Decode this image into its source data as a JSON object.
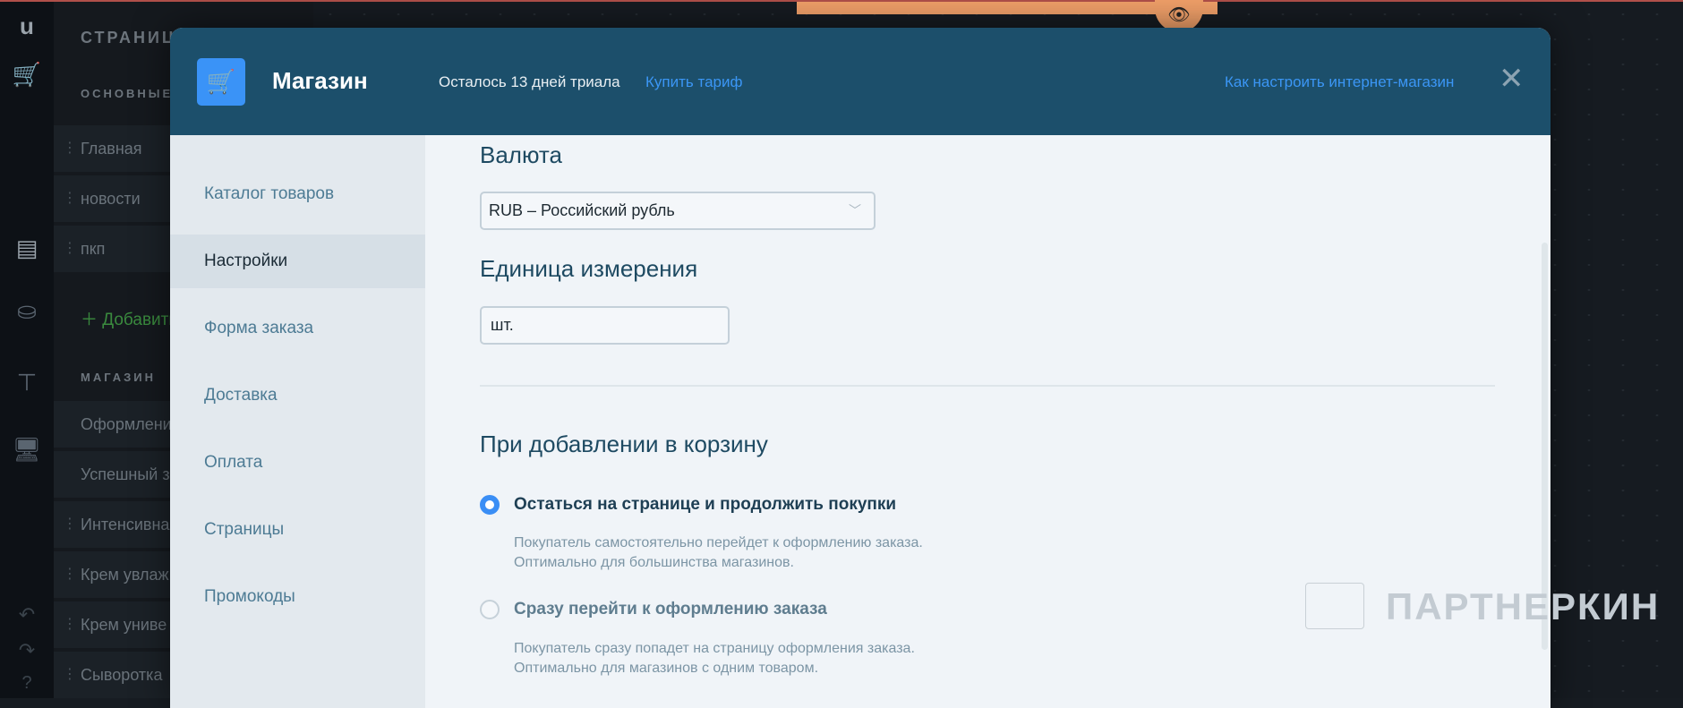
{
  "editor": {
    "logo": "u",
    "pages_title": "СТРАНИЦЫ",
    "section_main": "ОСНОВНЫЕ",
    "main_pages": [
      "Главная",
      "новости",
      "пкп"
    ],
    "add_page": "Добавить",
    "section_shop": "МАГАЗИН",
    "shop_pages": [
      "Оформление",
      "Успешный з",
      "Интенсивная",
      "Крем увлаж",
      "Крем униве",
      "Сыворотка"
    ]
  },
  "modal": {
    "title": "Магазин",
    "trial": "Осталось 13 дней триала",
    "buy_link": "Купить тариф",
    "help_link": "Как настроить интернет-магазин",
    "nav": [
      "Каталог товаров",
      "Настройки",
      "Форма заказа",
      "Доставка",
      "Оплата",
      "Страницы",
      "Промокоды"
    ],
    "active_nav": "Настройки",
    "currency_label": "Валюта",
    "currency_value": "RUB – Российский рубль",
    "unit_label": "Единица измерения",
    "unit_value": "шт.",
    "cart_heading": "При добавлении в корзину",
    "options": [
      {
        "label": "Остаться на странице и продолжить покупки",
        "desc1": "Покупатель самостоятельно перейдет к оформлению заказа.",
        "desc2": "Оптимально для большинства магазинов.",
        "selected": true
      },
      {
        "label": "Сразу перейти к оформлению заказа",
        "desc1": "Покупатель сразу попадет на страницу оформления заказа.",
        "desc2": "Оптимально для магазинов с одним товаром.",
        "selected": false
      }
    ]
  },
  "watermark": "ПАРТНЕРКИН",
  "colors": {
    "header": "#1c4f6b",
    "accent": "#3a93f7",
    "link": "#3b96f5"
  }
}
